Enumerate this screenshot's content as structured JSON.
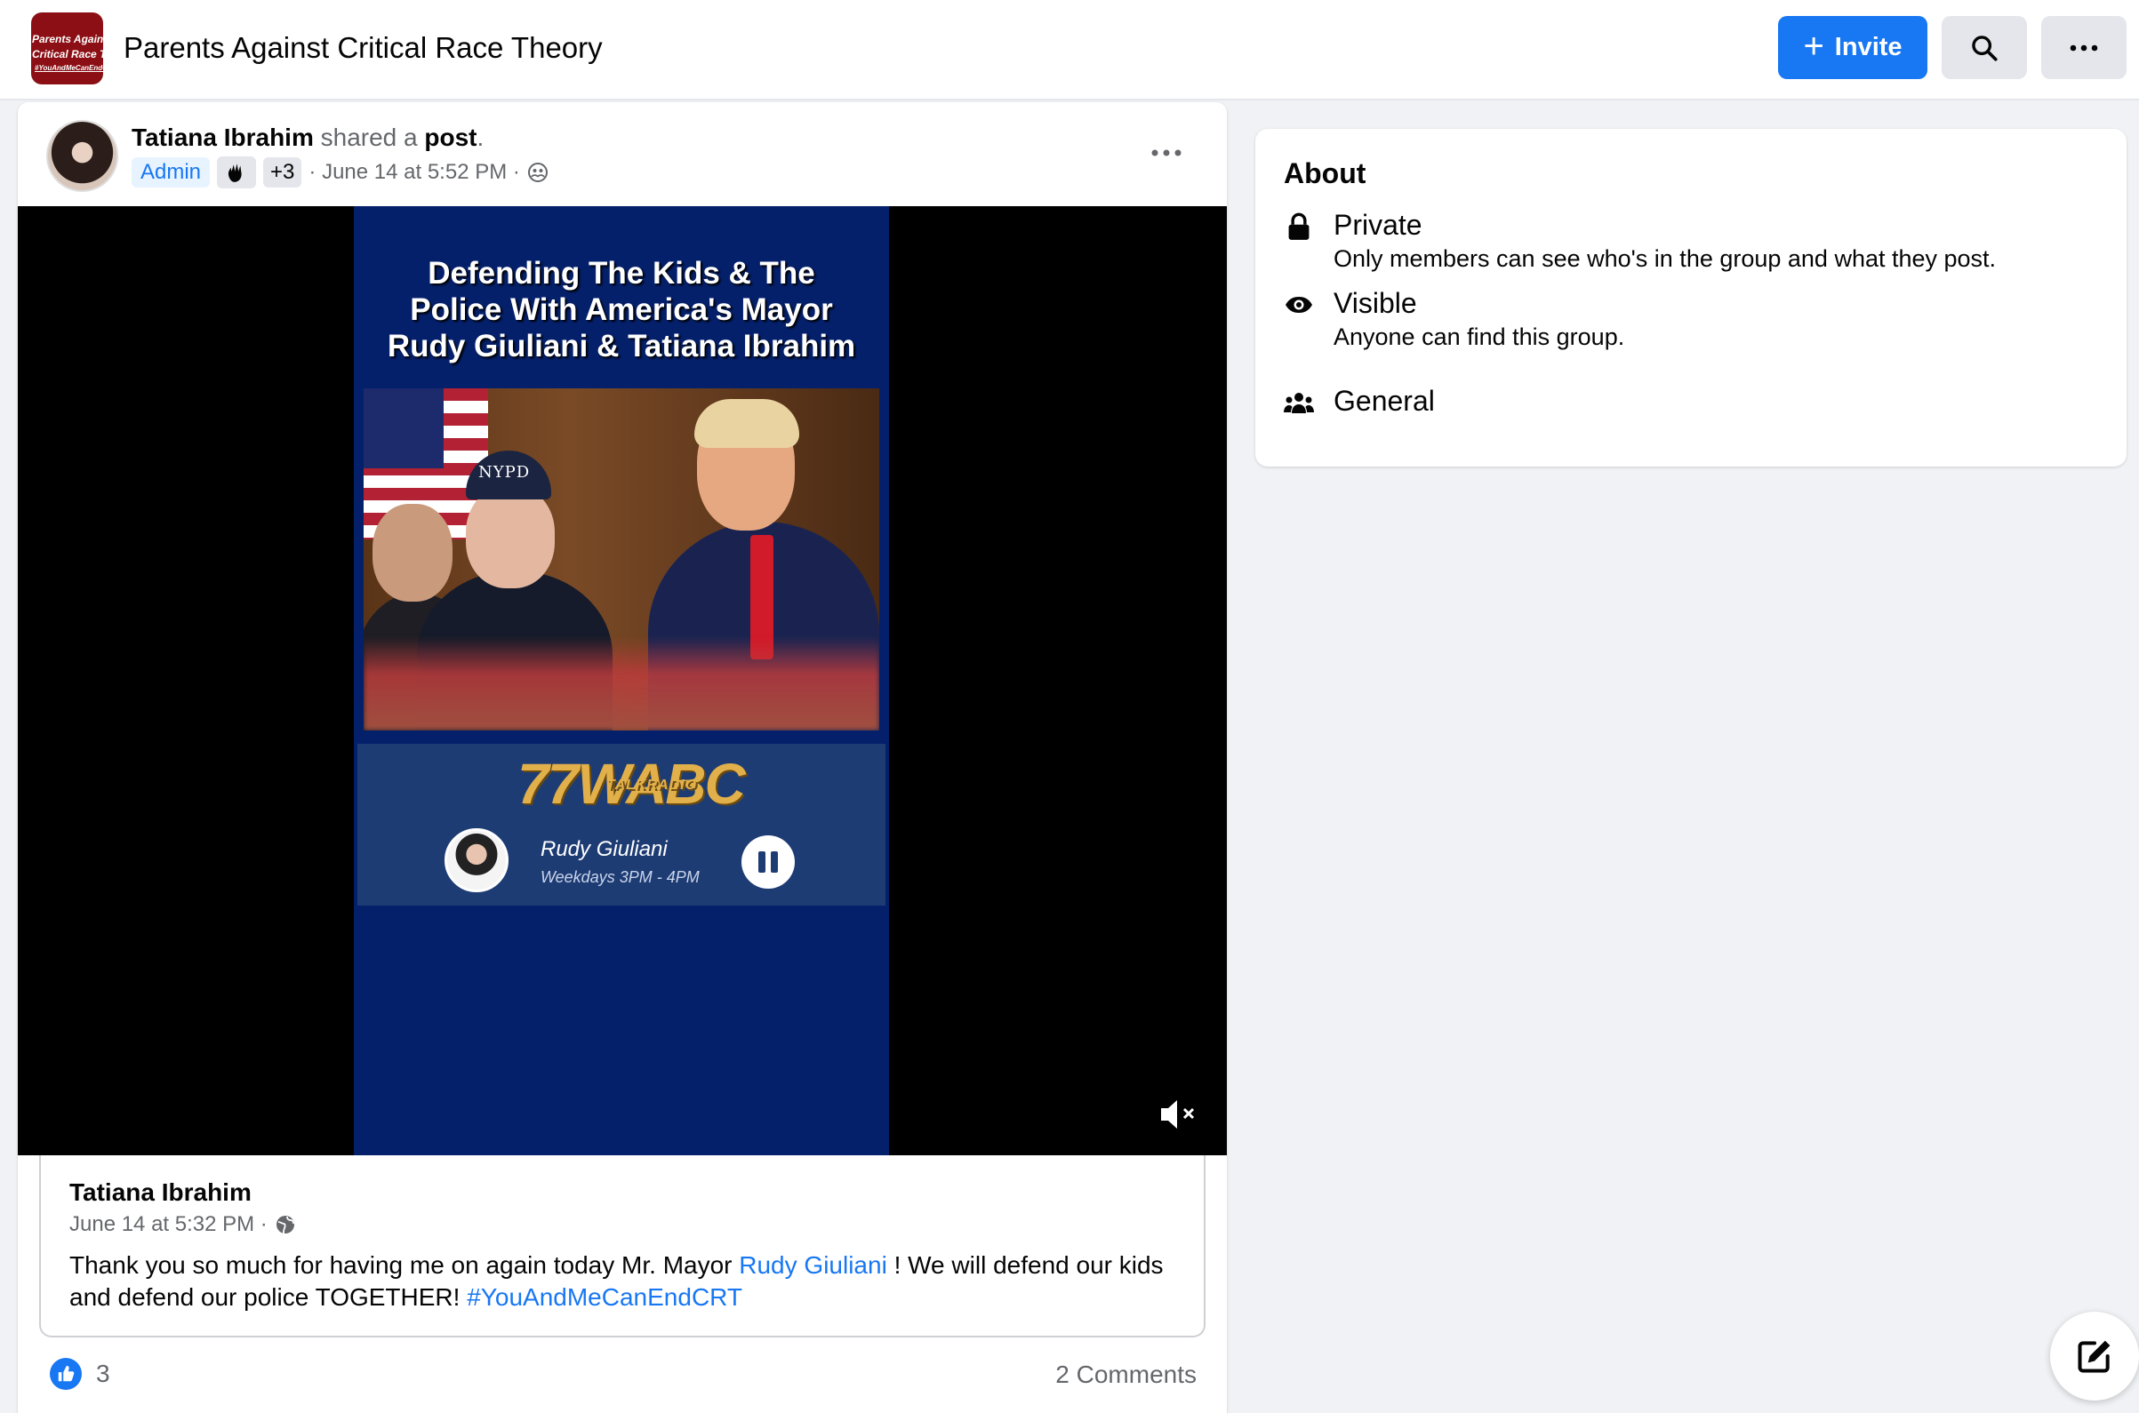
{
  "header": {
    "group_name": "Parents Against Critical Race Theory",
    "logo_lines": [
      "Parents Against",
      "Critical Race Theory",
      "#YouAndMeCanEndCRT"
    ],
    "invite_label": "Invite",
    "invite_icon": "plus-icon",
    "search_icon": "search-icon",
    "more_icon": "more-horizontal-icon",
    "accent_color": "#1877f2"
  },
  "post": {
    "author": "Tatiana Ibrahim",
    "action_text": "shared a",
    "object_text": "post",
    "period": ".",
    "badge_admin": "Admin",
    "badge_icon": "waving-hand-icon",
    "badge_more": "+3",
    "timestamp": "· June 14 at 5:52 PM ·",
    "audience_icon": "members-icon",
    "video": {
      "headline": "Defending The Kids & The Police With America's Mayor Rudy Giuliani & Tatiana Ibrahim",
      "cap_text": "NYPD",
      "station_number": "77",
      "station_sub": "TALKRADIO",
      "station_name": "WABC",
      "host_name": "Rudy Giuliani",
      "host_schedule": "Weekdays 3PM - 4PM",
      "pause_icon": "pause-icon",
      "mute_icon": "muted-speaker-icon"
    },
    "shared": {
      "author": "Tatiana Ibrahim",
      "timestamp": "June 14 at 5:32 PM ·",
      "audience_icon": "globe-icon",
      "text_before": "Thank you so much for having me on again today Mr. Mayor ",
      "mention": "Rudy Giuliani",
      "text_after": " ! We will defend our kids and defend our police TOGETHER! ",
      "hashtag": "#YouAndMeCanEndCRT"
    },
    "reaction_icon": "like-icon",
    "reaction_count": "3",
    "comments": "2 Comments"
  },
  "about": {
    "title": "About",
    "items": [
      {
        "icon": "lock-icon",
        "title": "Private",
        "desc": "Only members can see who's in the group and what they post."
      },
      {
        "icon": "eye-icon",
        "title": "Visible",
        "desc": "Anyone can find this group."
      },
      {
        "icon": "people-icon",
        "title": "General",
        "desc": ""
      }
    ]
  },
  "compose_icon": "compose-icon"
}
